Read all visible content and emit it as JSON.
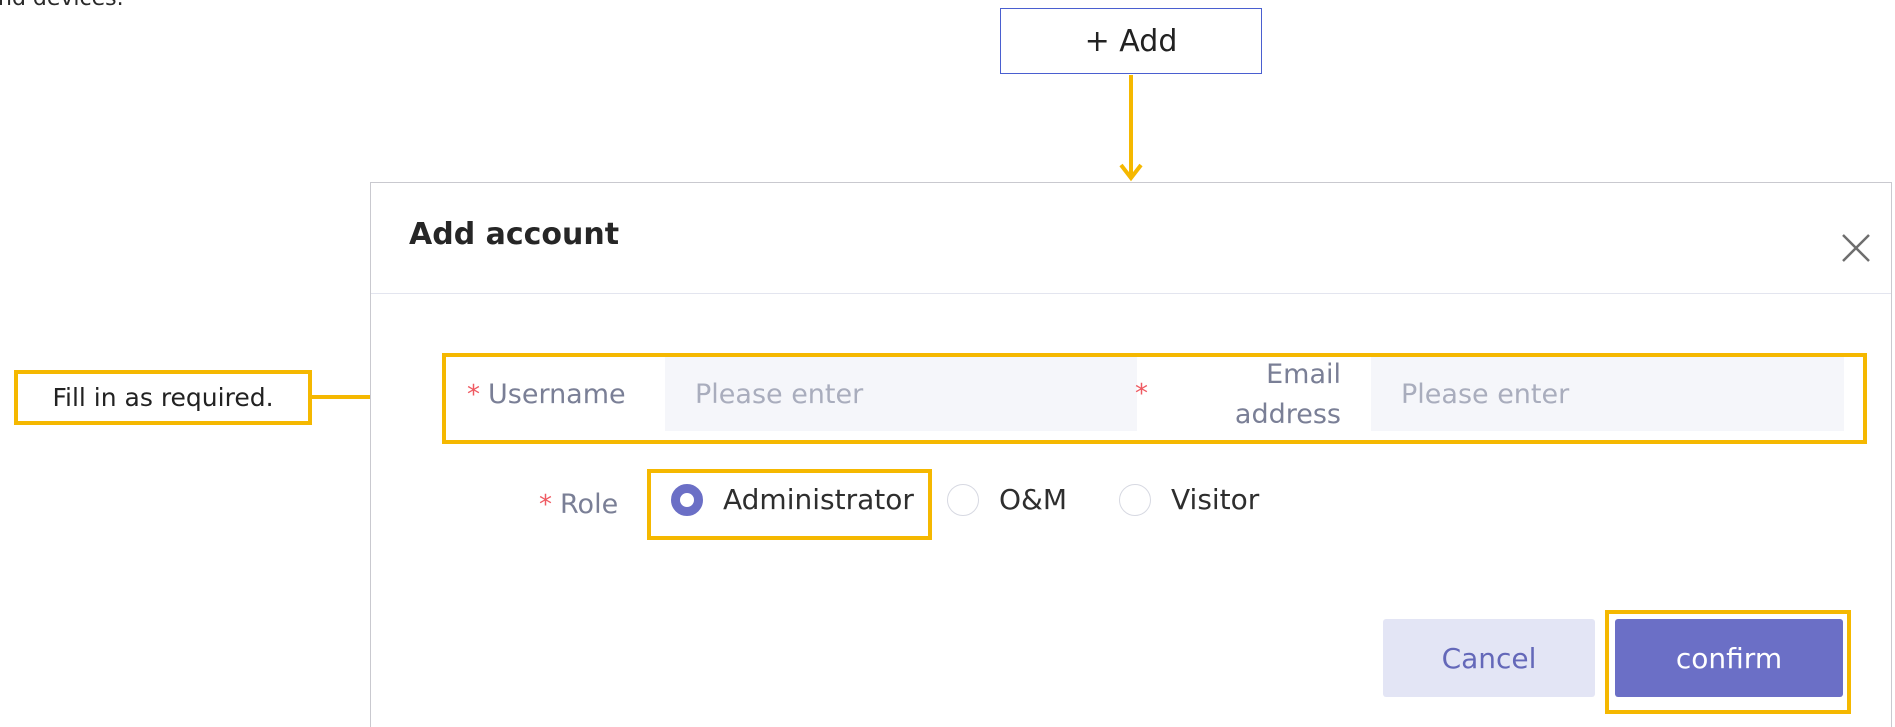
{
  "cutoff_text": "nd devices.",
  "add_button": {
    "label": "+ Add"
  },
  "dialog": {
    "title": "Add account",
    "username": {
      "required": "*",
      "label": "Username",
      "placeholder": "Please enter"
    },
    "email": {
      "required": "*",
      "label_line1": "Email",
      "label_line2": "address",
      "placeholder": "Please enter"
    },
    "role": {
      "required": "*",
      "label": "Role",
      "options": [
        {
          "label": "Administrator",
          "selected": true
        },
        {
          "label": "O&M",
          "selected": false
        },
        {
          "label": "Visitor",
          "selected": false
        }
      ]
    },
    "cancel_label": "Cancel",
    "confirm_label": "confirm"
  },
  "callout": {
    "text": "Fill in as required."
  },
  "colors": {
    "highlight": "#f5b800",
    "accent": "#6b6fc6",
    "required": "#ef5a62"
  }
}
